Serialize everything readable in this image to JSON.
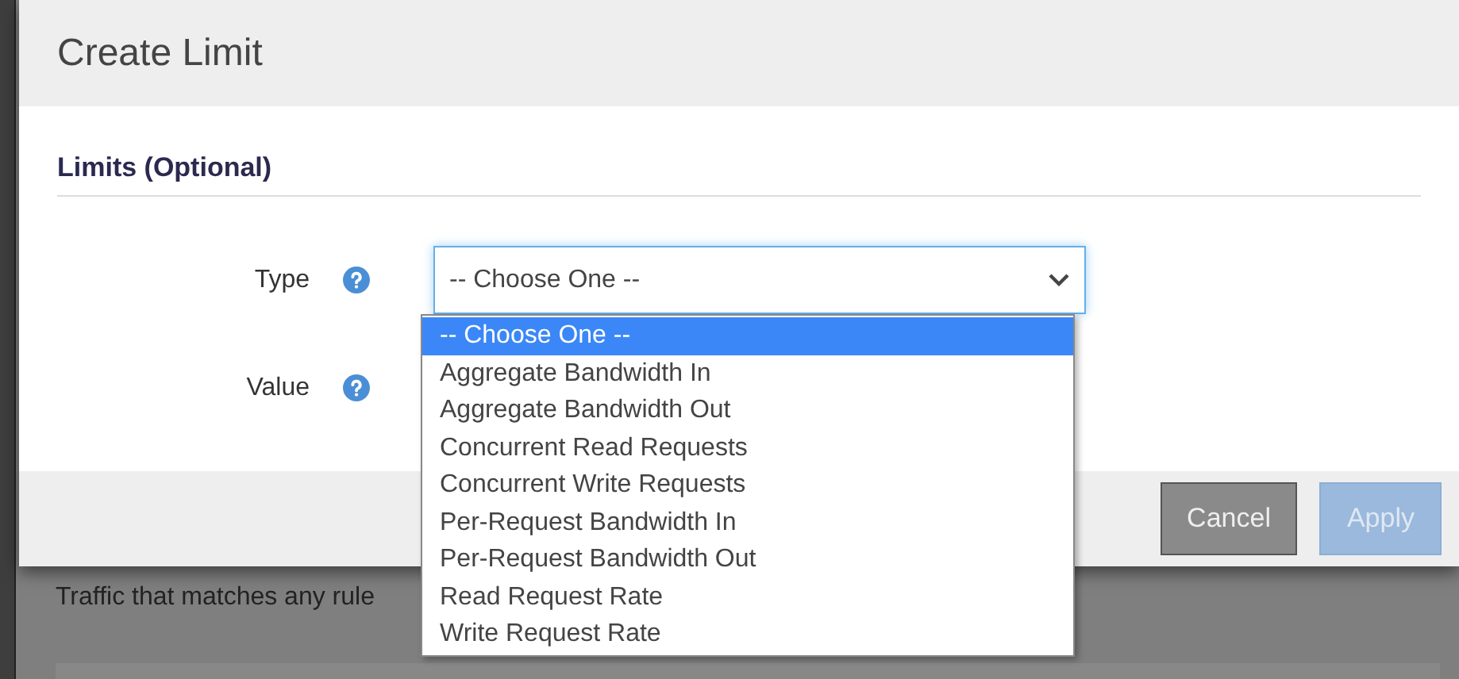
{
  "dialog": {
    "title": "Create Limit",
    "section_title": "Limits (Optional)",
    "fields": [
      {
        "label": "Type",
        "value": "-- Choose One --",
        "expanded": true,
        "options": [
          {
            "label": "-- Choose One --",
            "selected": true
          },
          {
            "label": "Aggregate Bandwidth In",
            "selected": false
          },
          {
            "label": "Aggregate Bandwidth Out",
            "selected": false
          },
          {
            "label": "Concurrent Read Requests",
            "selected": false
          },
          {
            "label": "Concurrent Write Requests",
            "selected": false
          },
          {
            "label": "Per-Request Bandwidth In",
            "selected": false
          },
          {
            "label": "Per-Request Bandwidth Out",
            "selected": false
          },
          {
            "label": "Read Request Rate",
            "selected": false
          },
          {
            "label": "Write Request Rate",
            "selected": false
          }
        ]
      },
      {
        "label": "Value"
      }
    ],
    "buttons": [
      {
        "label": "Cancel",
        "kind": "secondary",
        "disabled": false
      },
      {
        "label": "Apply",
        "kind": "primary",
        "disabled": true
      }
    ]
  },
  "background": {
    "text": "Traffic that matches any rule"
  }
}
